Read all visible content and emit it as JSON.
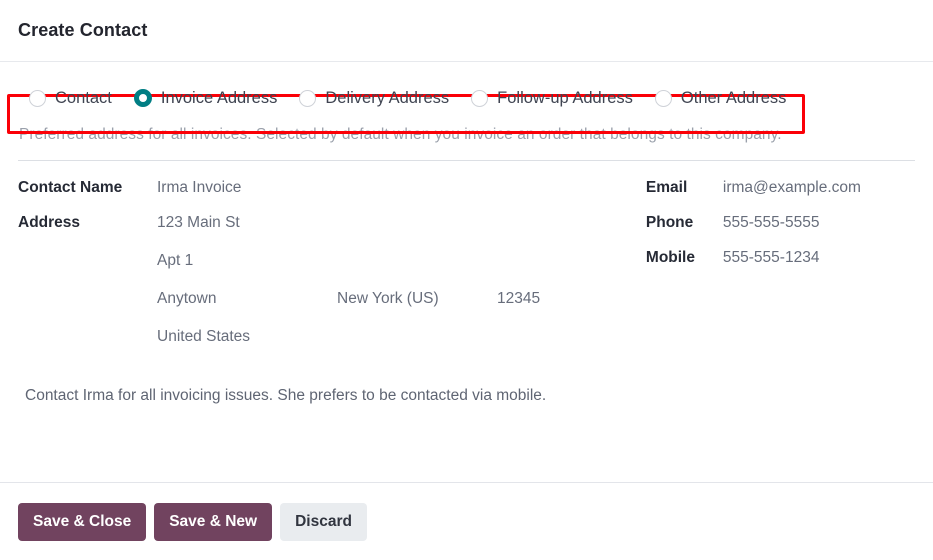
{
  "dialog": {
    "title": "Create Contact"
  },
  "address_type": {
    "selected": "Invoice Address",
    "options": [
      {
        "label": "Contact",
        "selected": false
      },
      {
        "label": "Invoice Address",
        "selected": true
      },
      {
        "label": "Delivery Address",
        "selected": false
      },
      {
        "label": "Follow-up Address",
        "selected": false
      },
      {
        "label": "Other Address",
        "selected": false
      }
    ],
    "help_text": "Preferred address for all invoices. Selected by default when you invoice an order that belongs to this company.",
    "highlight_color": "#fb0007",
    "selected_color": "#017e84"
  },
  "fields": {
    "contact_name_label": "Contact Name",
    "contact_name_value": "Irma Invoice",
    "address_label": "Address",
    "address": {
      "street": "123 Main St",
      "street2": "Apt 1",
      "city": "Anytown",
      "state": "New York (US)",
      "zip": "12345",
      "country": "United States"
    },
    "email_label": "Email",
    "email_value": "irma@example.com",
    "phone_label": "Phone",
    "phone_value": "555-555-5555",
    "mobile_label": "Mobile",
    "mobile_value": "555-555-1234"
  },
  "note": "Contact Irma for all invoicing issues. She prefers to be contacted via mobile.",
  "footer": {
    "save_close_label": "Save & Close",
    "save_new_label": "Save & New",
    "discard_label": "Discard",
    "primary_color": "#71435f",
    "secondary_color": "#e9ecef"
  }
}
